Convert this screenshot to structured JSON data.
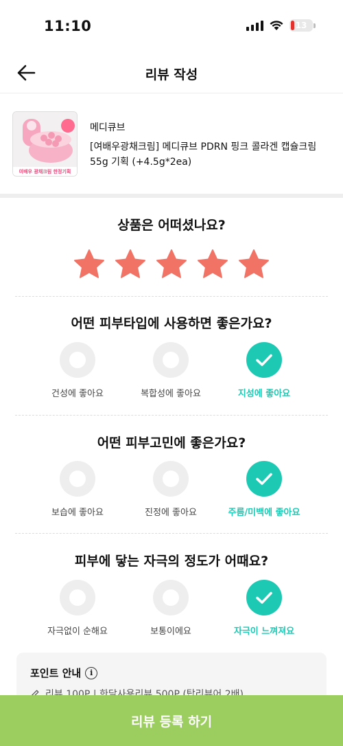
{
  "status": {
    "time": "11:10",
    "battery": "13"
  },
  "header": {
    "title": "리뷰 작성"
  },
  "product": {
    "brand": "메디큐브",
    "name": "[여배우광채크림] 메디큐브 PDRN 핑크 콜라겐 캡슐크림 55g 기획 (+4.5g*2ea)",
    "thumb_text": "여배우 광채크림 한정기획"
  },
  "rating": {
    "question": "상품은 어떠셨나요?",
    "value": 5,
    "max": 5,
    "color": "#f07366"
  },
  "questions": [
    {
      "title": "어떤 피부타입에 사용하면 좋은가요?",
      "options": [
        {
          "label": "건성에 좋아요",
          "selected": false
        },
        {
          "label": "복합성에 좋아요",
          "selected": false
        },
        {
          "label": "지성에 좋아요",
          "selected": true
        }
      ]
    },
    {
      "title": "어떤 피부고민에 좋은가요?",
      "options": [
        {
          "label": "보습에 좋아요",
          "selected": false
        },
        {
          "label": "진정에 좋아요",
          "selected": false
        },
        {
          "label": "주름/미백에 좋아요",
          "selected": true
        }
      ]
    },
    {
      "title": "피부에 닿는 자극의 정도가 어때요?",
      "options": [
        {
          "label": "자극없이 순해요",
          "selected": false
        },
        {
          "label": "보통이에요",
          "selected": false
        },
        {
          "label": "자극이 느껴져요",
          "selected": true
        }
      ]
    }
  ],
  "points": {
    "title": "포인트 안내",
    "line": "리뷰 100P | 한달사용리뷰 500P (탑리뷰어 2배)"
  },
  "submit": {
    "label": "리뷰 등록 하기"
  },
  "colors": {
    "accent": "#1ec9b4",
    "submit": "#9ccd5f",
    "star": "#f07366"
  }
}
